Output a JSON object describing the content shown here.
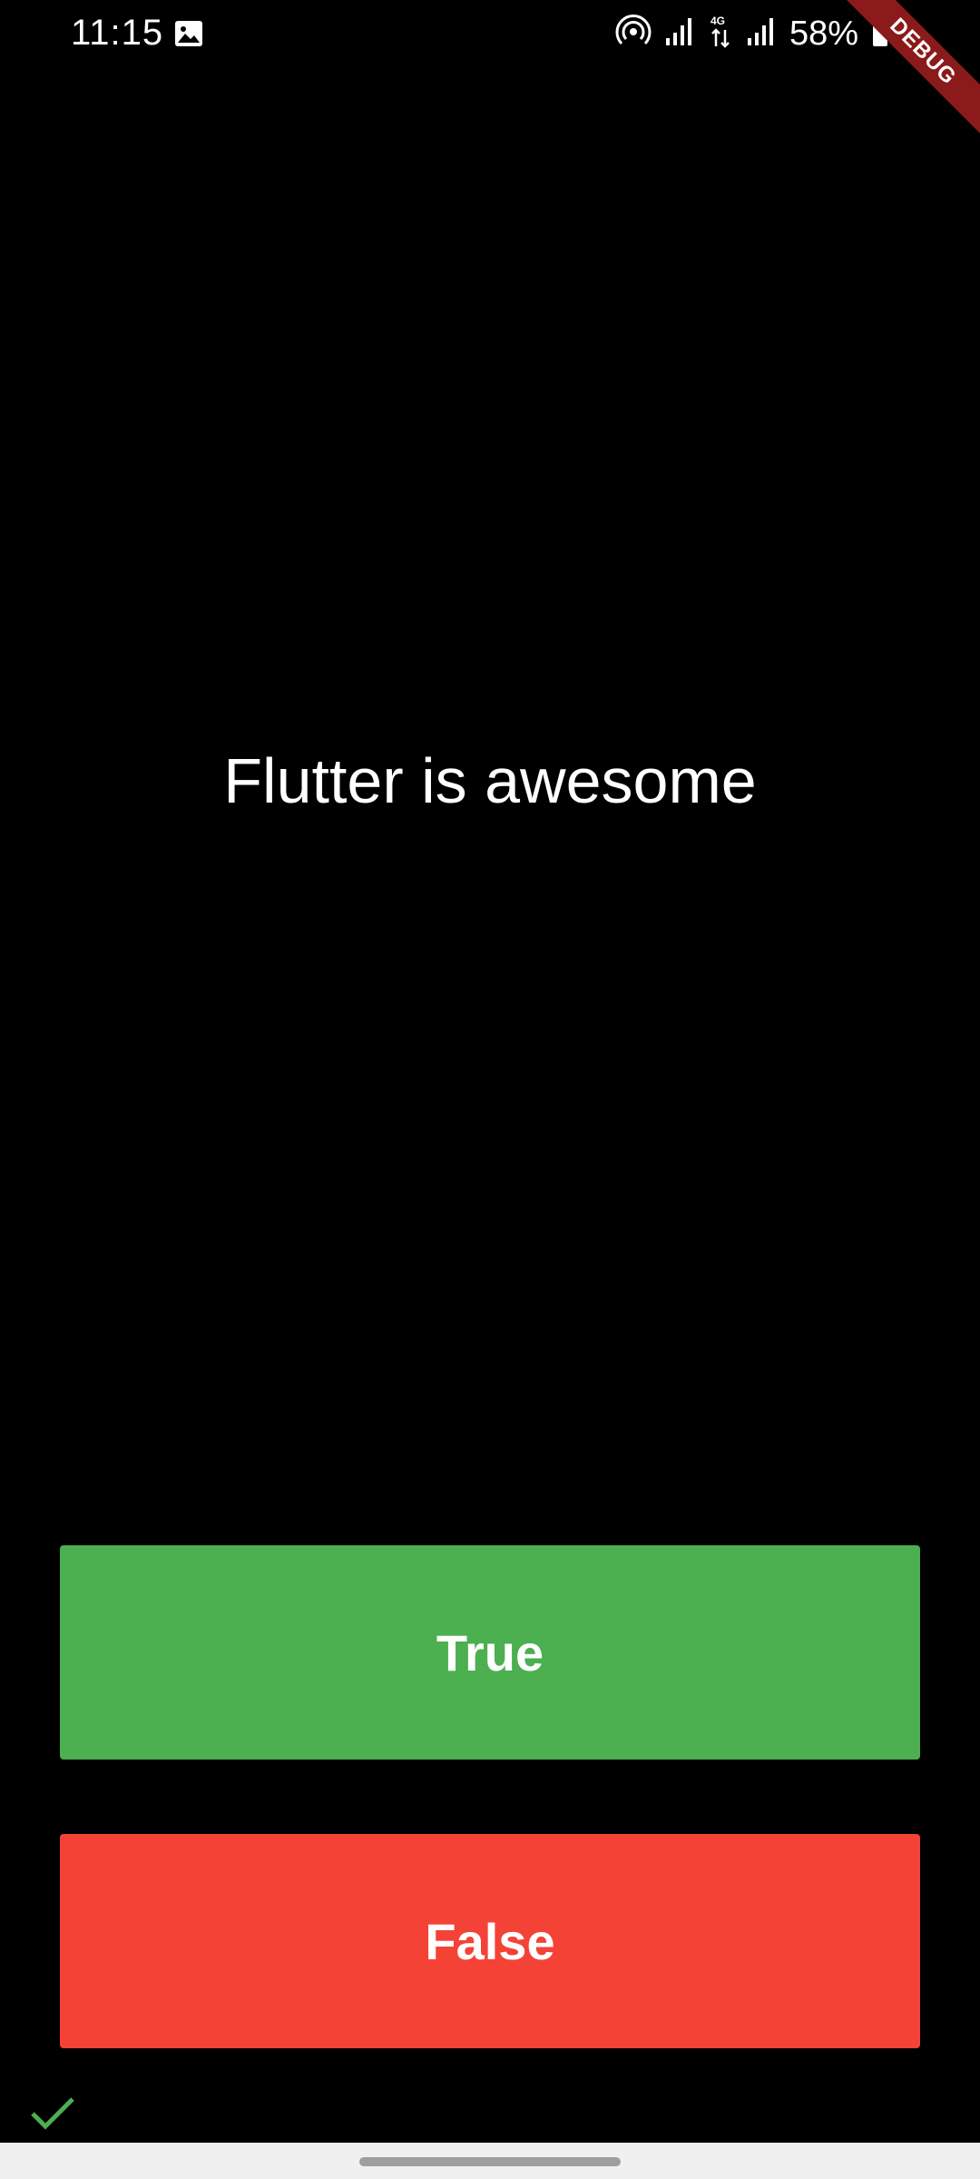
{
  "status_bar": {
    "time": "11:15",
    "battery": "58%",
    "network": "4G",
    "icons": [
      "gallery-icon",
      "hotspot-icon",
      "signal-icon",
      "data-arrows-icon",
      "signal-icon",
      "battery-icon"
    ]
  },
  "debug_banner": "DEBUG",
  "question": {
    "text": "Flutter is awesome"
  },
  "buttons": {
    "true_label": "True",
    "false_label": "False"
  },
  "score": {
    "icons": [
      "check-icon"
    ],
    "check_color": "#4caf50"
  },
  "colors": {
    "true_button": "#4caf50",
    "false_button": "#f44336",
    "background": "#000000"
  }
}
